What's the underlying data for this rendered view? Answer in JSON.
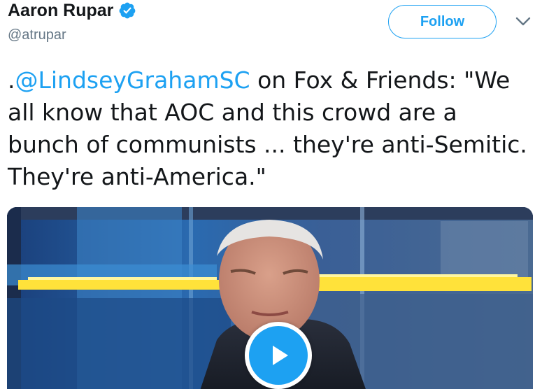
{
  "author": {
    "name": "Aaron Rupar",
    "handle": "@atrupar",
    "verified_icon": "verified-badge-icon"
  },
  "actions": {
    "follow_label": "Follow",
    "more_icon": "chevron-down-icon"
  },
  "tweet": {
    "prefix": ".",
    "mention": "@LindseyGrahamSC",
    "body": " on Fox & Friends: \"We all know that AOC and this crowd are a bunch of communists ... they're anti-Semitic. They're anti-America.\""
  },
  "media": {
    "type": "video",
    "play_icon": "play-icon"
  },
  "colors": {
    "accent": "#1da1f2",
    "text": "#14171a",
    "secondary": "#657786"
  }
}
